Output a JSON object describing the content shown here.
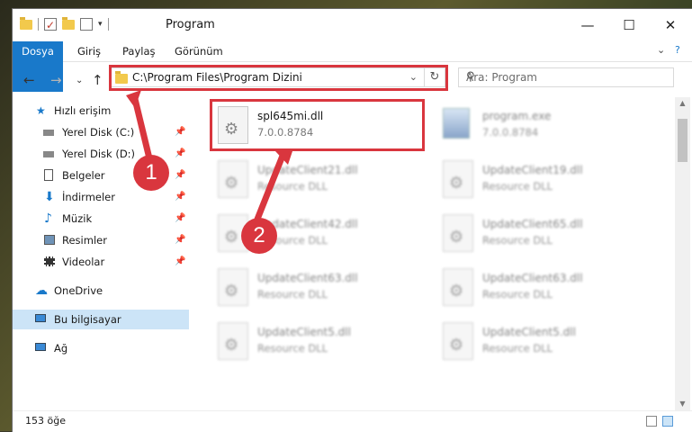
{
  "window": {
    "title": "Program"
  },
  "menu": {
    "file": "Dosya",
    "home": "Giriş",
    "share": "Paylaş",
    "view": "Görünüm"
  },
  "address": {
    "path": "C:\\Program Files\\Program Dizini"
  },
  "search": {
    "placeholder": "Ara: Program"
  },
  "sidebar": {
    "quick_access": "Hızlı erişim",
    "items": [
      {
        "label": "Yerel Disk (C:)",
        "icon": "drive-icon"
      },
      {
        "label": "Yerel Disk (D:)",
        "icon": "drive-icon"
      },
      {
        "label": "Belgeler",
        "icon": "documents-icon"
      },
      {
        "label": "İndirmeler",
        "icon": "download-icon"
      },
      {
        "label": "Müzik",
        "icon": "music-icon"
      },
      {
        "label": "Resimler",
        "icon": "pictures-icon"
      },
      {
        "label": "Videolar",
        "icon": "video-icon"
      }
    ],
    "onedrive": "OneDrive",
    "this_pc": "Bu bilgisayar",
    "network": "Ağ"
  },
  "files": [
    {
      "name": "spl645mi.dll",
      "desc": "7.0.0.8784",
      "highlighted": true
    },
    {
      "name": "program.exe",
      "desc": "7.0.0.8784"
    },
    {
      "name": "UpdateClient21.dll",
      "desc": "Resource DLL"
    },
    {
      "name": "UpdateClient19.dll",
      "desc": "Resource DLL"
    },
    {
      "name": "UpdateClient42.dll",
      "desc": "Resource DLL"
    },
    {
      "name": "UpdateClient65.dll",
      "desc": "Resource DLL"
    },
    {
      "name": "UpdateClient63.dll",
      "desc": "Resource DLL"
    },
    {
      "name": "UpdateClient63.dll",
      "desc": "Resource DLL"
    },
    {
      "name": "UpdateClient5.dll",
      "desc": "Resource DLL"
    },
    {
      "name": "UpdateClient5.dll",
      "desc": "Resource DLL"
    }
  ],
  "status": {
    "count": "153 öğe"
  },
  "annotations": {
    "step1": "1",
    "step2": "2",
    "color": "#d9363e"
  }
}
